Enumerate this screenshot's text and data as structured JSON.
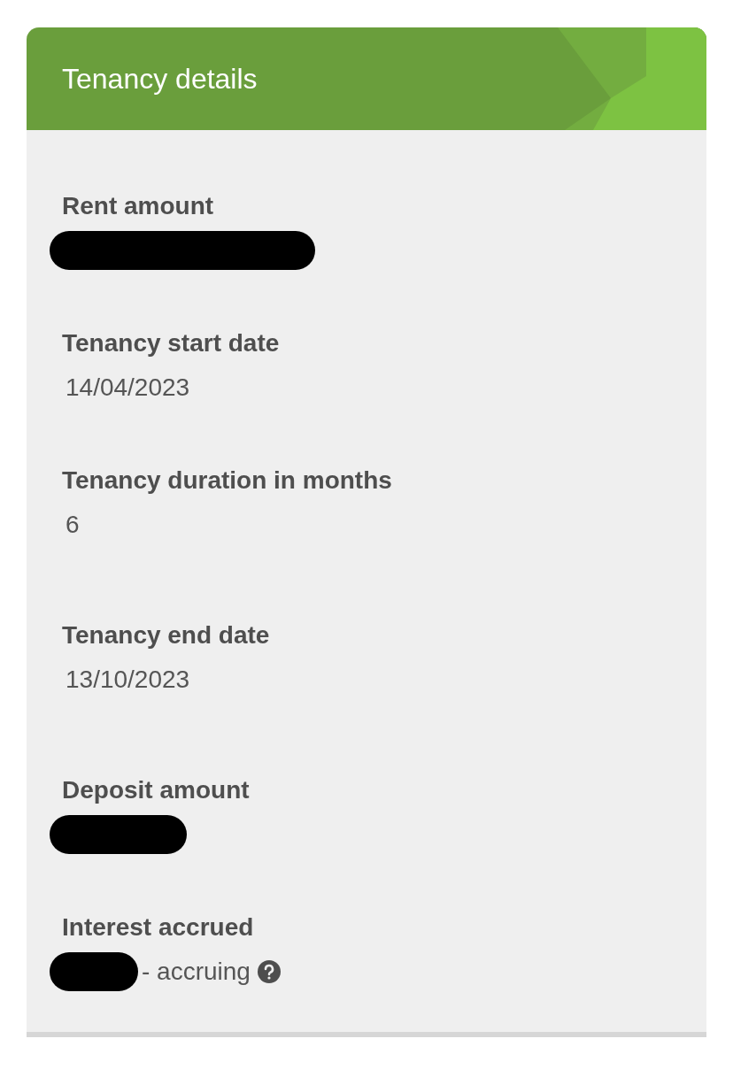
{
  "card": {
    "title": "Tenancy details"
  },
  "fields": [
    {
      "label": "Rent amount",
      "redacted": true
    },
    {
      "label": "Tenancy start date",
      "value": "14/04/2023",
      "redacted": false
    },
    {
      "label": "Tenancy duration in months",
      "value": "6",
      "redacted": false
    },
    {
      "label": "Tenancy end date",
      "value": "13/10/2023",
      "redacted": false
    },
    {
      "label": "Deposit amount",
      "redacted": true
    },
    {
      "label": "Interest accrued",
      "value": "- accruing",
      "redacted": true,
      "help": true
    }
  ]
}
